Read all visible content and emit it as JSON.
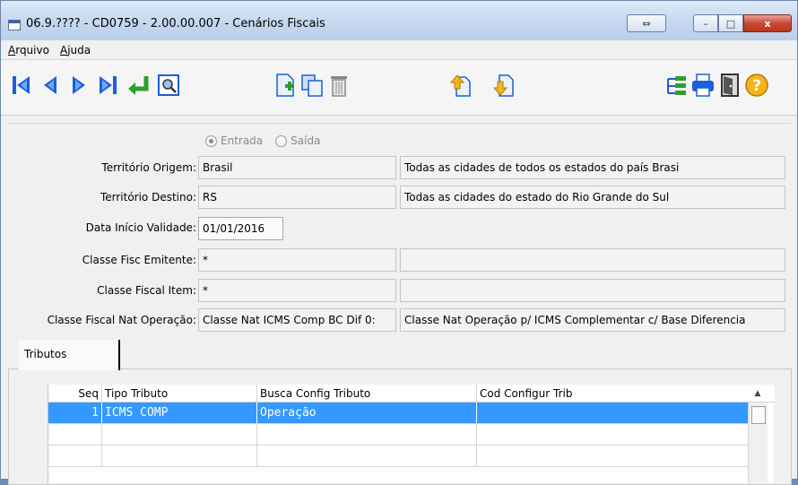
{
  "window": {
    "title": "06.9.???? - CD0759 - 2.00.00.007 - Cenários Fiscais",
    "resize_glyph": "⇔",
    "min_glyph": "–",
    "max_glyph": "□",
    "close_glyph": "x"
  },
  "menu": {
    "items": [
      {
        "label_first": "A",
        "label_rest": "rquivo"
      },
      {
        "label_first": "A",
        "label_rest": "juda"
      }
    ]
  },
  "toolbar": {
    "icons": [
      "first-record-icon",
      "prev-record-icon",
      "next-record-icon",
      "last-record-icon",
      "goto-icon",
      "search-icon",
      "new-icon",
      "copy-icon",
      "delete-icon",
      "import-icon",
      "export-icon",
      "tree-icon",
      "print-icon",
      "exit-icon",
      "help-icon"
    ]
  },
  "form": {
    "radio": {
      "entrada": "Entrada",
      "saida": "Saída"
    },
    "territorio_origem": {
      "label": "Território Origem:",
      "value": "Brasil",
      "desc": "Todas as cidades de todos os estados do país Brasi"
    },
    "territorio_destino": {
      "label": "Território Destino:",
      "value": "RS",
      "desc": "Todas as cidades do estado do Rio Grande do Sul"
    },
    "data_inicio": {
      "label": "Data Início Validade:",
      "value": "01/01/2016"
    },
    "classe_emitente": {
      "label": "Classe Fisc Emitente:",
      "value": "*",
      "desc": ""
    },
    "classe_item": {
      "label": "Classe Fiscal Item:",
      "value": "*",
      "desc": ""
    },
    "classe_nat": {
      "label": "Classe Fiscal Nat Operação:",
      "value": "Classe Nat ICMS Comp BC Dif 0:",
      "desc": "Classe Nat Operação p/ ICMS Complementar c/ Base Diferencia"
    }
  },
  "tabs": {
    "active": "Tributos"
  },
  "grid": {
    "headers": [
      "Seq",
      "Tipo Tributo",
      "Busca Config Tributo",
      "Cod Configur Trib"
    ],
    "rows": [
      {
        "seq": "1",
        "tipo": "ICMS COMP",
        "busca": "Operação",
        "cod": ""
      }
    ],
    "scroll_up": "▲"
  },
  "colors": {
    "selection": "#3399ff",
    "close": "#c94a33",
    "icon_blue": "#1b5fd9",
    "icon_yellow": "#f6b41a"
  }
}
